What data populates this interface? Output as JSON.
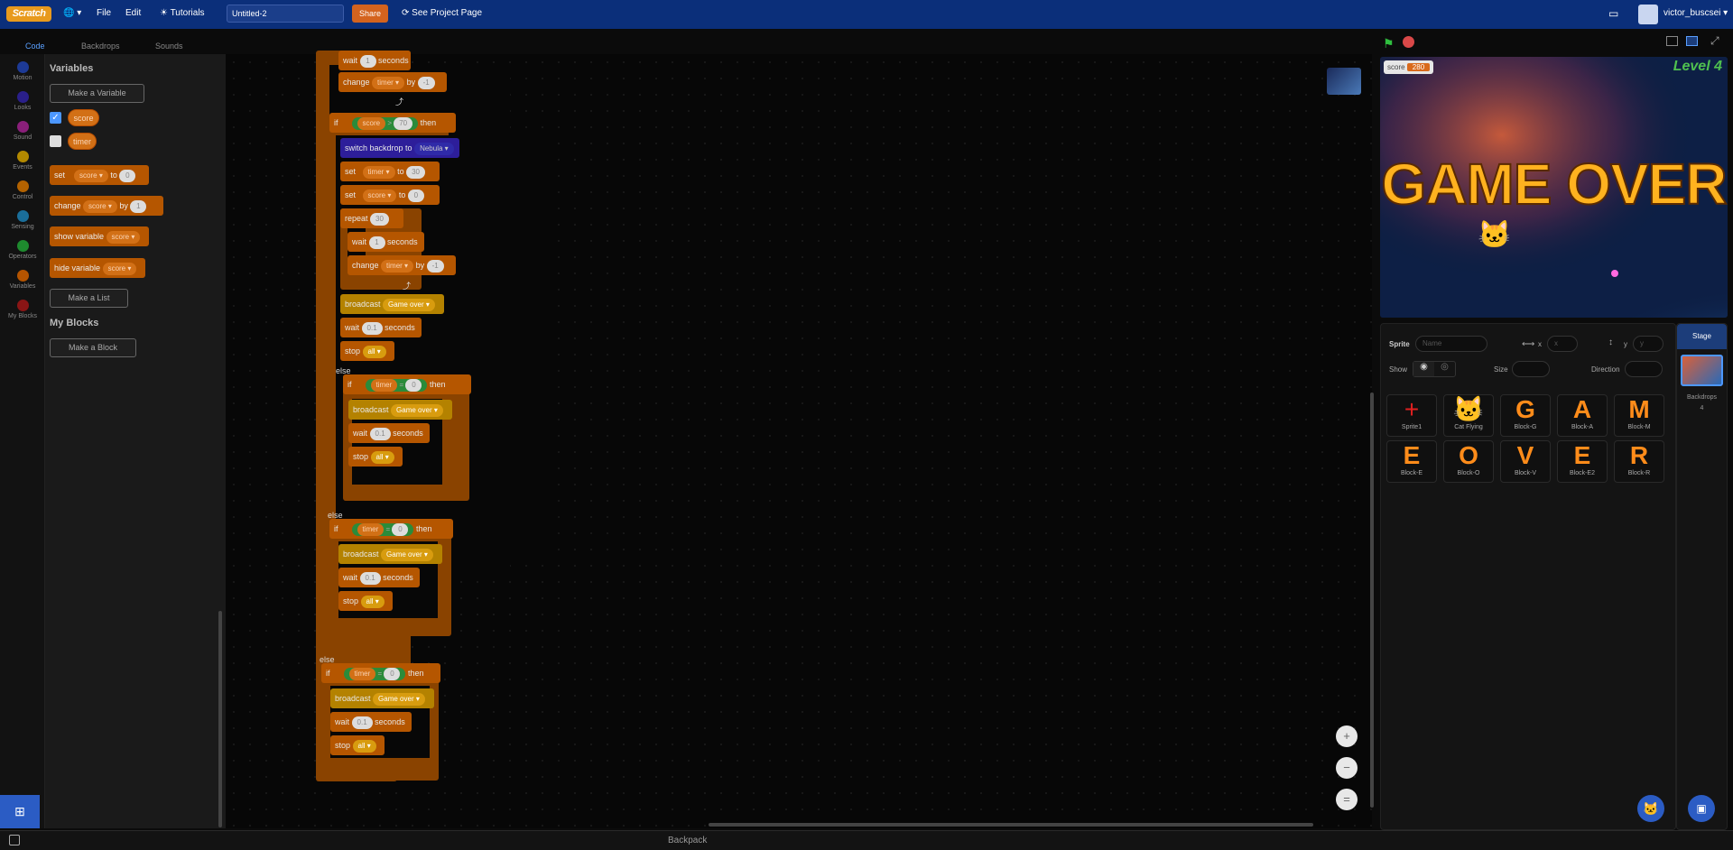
{
  "menubar": {
    "logo_text": "Scratch",
    "file": "File",
    "edit": "Edit",
    "tutorials": "Tutorials",
    "project_title": "Untitled-2",
    "share": "Share",
    "see_project_page": "See Project Page",
    "username": "victor_buscsei"
  },
  "tabs": {
    "code": "Code",
    "backdrops": "Backdrops",
    "sounds": "Sounds"
  },
  "categories": [
    {
      "label": "Motion",
      "color": "#1d3a96"
    },
    {
      "label": "Looks",
      "color": "#2a1f8a"
    },
    {
      "label": "Sound",
      "color": "#8a1f7a"
    },
    {
      "label": "Events",
      "color": "#b38900"
    },
    {
      "label": "Control",
      "color": "#b36200"
    },
    {
      "label": "Sensing",
      "color": "#1a6e9a"
    },
    {
      "label": "Operators",
      "color": "#1e8a2e"
    },
    {
      "label": "Variables",
      "color": "#b45400"
    },
    {
      "label": "My Blocks",
      "color": "#8a1515"
    }
  ],
  "palette": {
    "variables_heading": "Variables",
    "make_variable": "Make a Variable",
    "var_score": "score",
    "var_timer": "timer",
    "set_label": "set",
    "set_var": "score",
    "set_to": "to",
    "set_value": "0",
    "change_label": "change",
    "change_var": "score",
    "change_by": "by",
    "change_value": "1",
    "show_label": "show variable",
    "show_var": "score",
    "hide_label": "hide variable",
    "hide_var": "score",
    "make_list": "Make a List",
    "myblocks_heading": "My Blocks",
    "make_block": "Make a Block"
  },
  "script": {
    "wait": "wait",
    "seconds": "seconds",
    "change": "change",
    "by": "by",
    "if": "if",
    "then": "then",
    "else": "else",
    "set": "set",
    "to": "to",
    "repeat": "repeat",
    "broadcast": "broadcast",
    "stop": "stop",
    "switch_backdrop": "switch backdrop to",
    "timer": "timer",
    "score": "score",
    "all": "all",
    "game_over": "Game over",
    "nebula": "Nebula",
    "v1": "1",
    "vneg1": "-1",
    "v70": "70",
    "v30": "30",
    "v0": "0",
    "v01": "0.1",
    "gt": ">",
    "eq": "="
  },
  "stage": {
    "score_label": "score",
    "score_value": "280",
    "level_text": "Level 4",
    "game_over_text": "GAME OVER"
  },
  "sprite_info": {
    "sprite_label": "Sprite",
    "name_placeholder": "Name",
    "x_label": "x",
    "x_value": "x",
    "y_label": "y",
    "y_value": "y",
    "show_label": "Show",
    "size_label": "Size",
    "direction_label": "Direction"
  },
  "sprites": [
    {
      "name": "Sprite1",
      "glyph": "+"
    },
    {
      "name": "Cat Flying",
      "glyph": "🐱"
    },
    {
      "name": "Block-G",
      "glyph": "G"
    },
    {
      "name": "Block-A",
      "glyph": "A"
    },
    {
      "name": "Block-M",
      "glyph": "M"
    },
    {
      "name": "Block-E",
      "glyph": "E"
    },
    {
      "name": "Block-O",
      "glyph": "O"
    },
    {
      "name": "Block-V",
      "glyph": "V"
    },
    {
      "name": "Block-E2",
      "glyph": "E"
    },
    {
      "name": "Block-R",
      "glyph": "R"
    }
  ],
  "stage_panel": {
    "title": "Stage",
    "backdrops_label": "Backdrops",
    "backdrops_count": "4"
  },
  "bottom": {
    "backpack": "Backpack"
  }
}
